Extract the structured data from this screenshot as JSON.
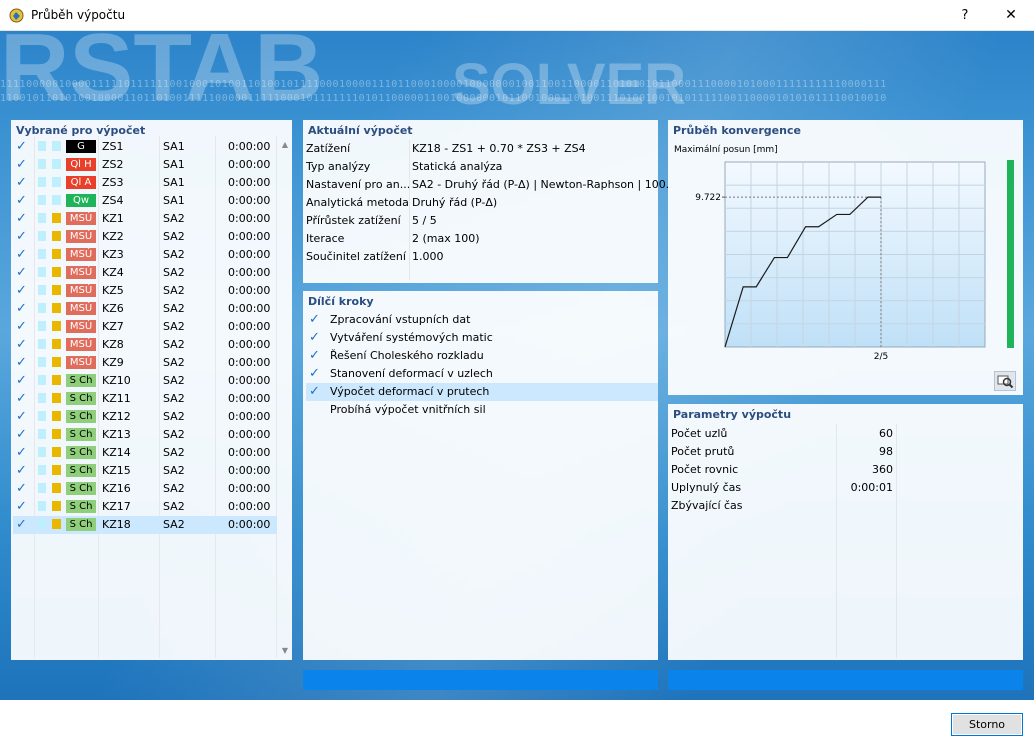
{
  "window": {
    "title": "Průběh výpočtu",
    "help": "?",
    "close": "✕"
  },
  "background": {
    "word1": "RSTAB",
    "word2": "SOLVER",
    "binary_line1": "1111000001000011111011111100100010100110100101111000100001110110001000010000000100110011000011010101011000111000010100011111111110000111",
    "binary_line2": "1100101101010010000110110100111110000011111000101111111010110000011001000000101100100011010011101001001010111110011000010101011110010010"
  },
  "left_panel": {
    "title": "Vybrané pro výpočet",
    "rows": [
      {
        "tag": "G",
        "tag_bg": "#000000",
        "tag_fg": "#ffffff",
        "name": "ZS1",
        "type": "SA1",
        "time": "0:00:00",
        "sq2": "#bdeffc"
      },
      {
        "tag": "Ql H",
        "tag_bg": "#e8402a",
        "tag_fg": "#ffffff",
        "name": "ZS2",
        "type": "SA1",
        "time": "0:00:00",
        "sq2": "#bdeffc"
      },
      {
        "tag": "Ql A",
        "tag_bg": "#e8402a",
        "tag_fg": "#ffffff",
        "name": "ZS3",
        "type": "SA1",
        "time": "0:00:00",
        "sq2": "#bdeffc"
      },
      {
        "tag": "Qw",
        "tag_bg": "#1fb45a",
        "tag_fg": "#ffffff",
        "name": "ZS4",
        "type": "SA1",
        "time": "0:00:00",
        "sq2": "#bdeffc"
      },
      {
        "tag": "MSÚ",
        "tag_bg": "#e06c5c",
        "tag_fg": "#ffffff",
        "name": "KZ1",
        "type": "SA2",
        "time": "0:00:00",
        "sq2": "#e8b800"
      },
      {
        "tag": "MSÚ",
        "tag_bg": "#e06c5c",
        "tag_fg": "#ffffff",
        "name": "KZ2",
        "type": "SA2",
        "time": "0:00:00",
        "sq2": "#e8b800"
      },
      {
        "tag": "MSÚ",
        "tag_bg": "#e06c5c",
        "tag_fg": "#ffffff",
        "name": "KZ3",
        "type": "SA2",
        "time": "0:00:00",
        "sq2": "#e8b800"
      },
      {
        "tag": "MSÚ",
        "tag_bg": "#e06c5c",
        "tag_fg": "#ffffff",
        "name": "KZ4",
        "type": "SA2",
        "time": "0:00:00",
        "sq2": "#e8b800"
      },
      {
        "tag": "MSÚ",
        "tag_bg": "#e06c5c",
        "tag_fg": "#ffffff",
        "name": "KZ5",
        "type": "SA2",
        "time": "0:00:00",
        "sq2": "#e8b800"
      },
      {
        "tag": "MSÚ",
        "tag_bg": "#e06c5c",
        "tag_fg": "#ffffff",
        "name": "KZ6",
        "type": "SA2",
        "time": "0:00:00",
        "sq2": "#e8b800"
      },
      {
        "tag": "MSÚ",
        "tag_bg": "#e06c5c",
        "tag_fg": "#ffffff",
        "name": "KZ7",
        "type": "SA2",
        "time": "0:00:00",
        "sq2": "#e8b800"
      },
      {
        "tag": "MSÚ",
        "tag_bg": "#e06c5c",
        "tag_fg": "#ffffff",
        "name": "KZ8",
        "type": "SA2",
        "time": "0:00:00",
        "sq2": "#e8b800"
      },
      {
        "tag": "MSÚ",
        "tag_bg": "#e06c5c",
        "tag_fg": "#ffffff",
        "name": "KZ9",
        "type": "SA2",
        "time": "0:00:00",
        "sq2": "#e8b800"
      },
      {
        "tag": "S Ch",
        "tag_bg": "#8fce7a",
        "tag_fg": "#000000",
        "name": "KZ10",
        "type": "SA2",
        "time": "0:00:00",
        "sq2": "#e8b800"
      },
      {
        "tag": "S Ch",
        "tag_bg": "#8fce7a",
        "tag_fg": "#000000",
        "name": "KZ11",
        "type": "SA2",
        "time": "0:00:00",
        "sq2": "#e8b800"
      },
      {
        "tag": "S Ch",
        "tag_bg": "#8fce7a",
        "tag_fg": "#000000",
        "name": "KZ12",
        "type": "SA2",
        "time": "0:00:00",
        "sq2": "#e8b800"
      },
      {
        "tag": "S Ch",
        "tag_bg": "#8fce7a",
        "tag_fg": "#000000",
        "name": "KZ13",
        "type": "SA2",
        "time": "0:00:00",
        "sq2": "#e8b800"
      },
      {
        "tag": "S Ch",
        "tag_bg": "#8fce7a",
        "tag_fg": "#000000",
        "name": "KZ14",
        "type": "SA2",
        "time": "0:00:00",
        "sq2": "#e8b800"
      },
      {
        "tag": "S Ch",
        "tag_bg": "#8fce7a",
        "tag_fg": "#000000",
        "name": "KZ15",
        "type": "SA2",
        "time": "0:00:00",
        "sq2": "#e8b800"
      },
      {
        "tag": "S Ch",
        "tag_bg": "#8fce7a",
        "tag_fg": "#000000",
        "name": "KZ16",
        "type": "SA2",
        "time": "0:00:00",
        "sq2": "#e8b800"
      },
      {
        "tag": "S Ch",
        "tag_bg": "#8fce7a",
        "tag_fg": "#000000",
        "name": "KZ17",
        "type": "SA2",
        "time": "0:00:00",
        "sq2": "#e8b800"
      },
      {
        "tag": "S Ch",
        "tag_bg": "#8fce7a",
        "tag_fg": "#000000",
        "name": "KZ18",
        "type": "SA2",
        "time": "0:00:00",
        "sq2": "#e8b800",
        "selected": true
      }
    ]
  },
  "current": {
    "title": "Aktuální výpočet",
    "rows": [
      {
        "k": "Zatížení",
        "v": "KZ18 - ZS1 + 0.70 * ZS3 + ZS4"
      },
      {
        "k": "Typ analýzy",
        "v": "Statická analýza"
      },
      {
        "k": "Nastavení pro an...",
        "v": "SA2 - Druhý řád (P-Δ) | Newton-Raphson | 100..."
      },
      {
        "k": "Analytická metoda",
        "v": "Druhý řád (P-Δ)"
      },
      {
        "k": "Přírůstek zatížení",
        "v": "5 / 5"
      },
      {
        "k": "Iterace",
        "v": "2 (max 100)"
      },
      {
        "k": "Součinitel zatížení",
        "v": "1.000"
      }
    ]
  },
  "steps": {
    "title": "Dílčí kroky",
    "items": [
      {
        "label": "Zpracování vstupních dat",
        "done": true
      },
      {
        "label": "Vytváření systémových matic",
        "done": true
      },
      {
        "label": "Řešení Choleského rozkladu",
        "done": true
      },
      {
        "label": "Stanovení deformací v uzlech",
        "done": true
      },
      {
        "label": "Výpočet deformací v prutech",
        "done": true,
        "highlight": true
      },
      {
        "label": "Probíhá výpočet vnitřních sil",
        "done": false
      }
    ]
  },
  "convergence": {
    "title": "Průběh konvergence",
    "zoom_icon": "magnifier-icon"
  },
  "chart_data": {
    "type": "line",
    "title": "",
    "ylabel": "Maximální posun [mm]",
    "xlabel": "",
    "x_tick_label": "2/5",
    "y_tick_label": "9.722",
    "x": [
      0,
      0.35,
      0.6,
      0.95,
      1.2,
      1.55,
      1.8,
      2.15,
      2.4,
      2.75,
      3.0
    ],
    "y": [
      0,
      3.9,
      3.9,
      5.8,
      5.8,
      7.8,
      7.8,
      8.6,
      8.6,
      9.722,
      9.722
    ],
    "xlim": [
      0,
      5
    ],
    "ylim": [
      0,
      12
    ],
    "marker_x": 3.0,
    "grid": true
  },
  "params": {
    "title": "Parametry výpočtu",
    "rows": [
      {
        "k": "Počet uzlů",
        "v": "60"
      },
      {
        "k": "Počet prutů",
        "v": "98"
      },
      {
        "k": "Počet rovnic",
        "v": "360"
      },
      {
        "k": "Uplynulý čas",
        "v": "0:00:01"
      },
      {
        "k": "Zbývající čas",
        "v": ""
      }
    ]
  },
  "progress": {
    "mid": 1.0,
    "right": 1.0
  },
  "footer": {
    "cancel": "Storno"
  },
  "colors": {
    "accent": "#0a84ea",
    "check": "#1f6fc5",
    "panel_title": "#2b4d80",
    "level_bar": "#1fb45a"
  }
}
